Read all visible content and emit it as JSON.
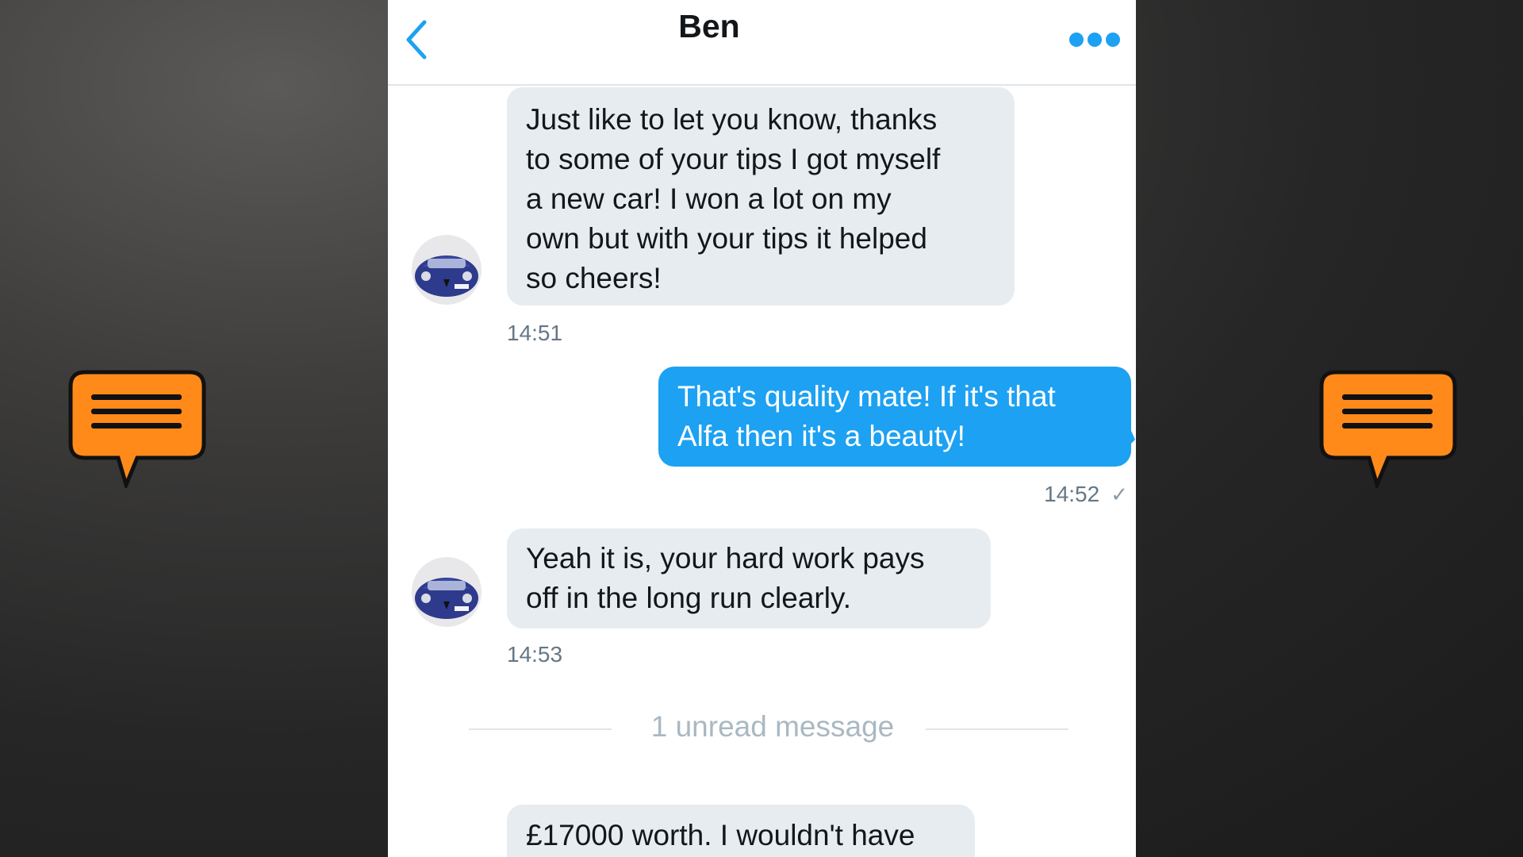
{
  "header": {
    "title": "Ben"
  },
  "icons": {
    "back": "chevron-left-icon",
    "more": "more-options-icon",
    "side": "speech-bubble-icon"
  },
  "colors": {
    "accent": "#1da1f2",
    "incoming_bubble": "#e6ecf0",
    "side_icon": "#ff8a1a"
  },
  "messages": [
    {
      "direction": "incoming",
      "text": "Just like to let you know, thanks\nto some of your tips I got myself\na new car! I won a lot on my\nown but with your tips it helped\nso cheers!",
      "time": "14:51"
    },
    {
      "direction": "outgoing",
      "text": "That's quality mate! If it's that\nAlfa then it's a beauty!",
      "time": "14:52",
      "status": "✓"
    },
    {
      "direction": "incoming",
      "text": "Yeah it is, your hard work pays\noff in the long run clearly.",
      "time": "14:53"
    },
    {
      "direction": "incoming",
      "text": "£17000 worth. I wouldn't have",
      "time": ""
    }
  ],
  "unread_divider": "1 unread message"
}
